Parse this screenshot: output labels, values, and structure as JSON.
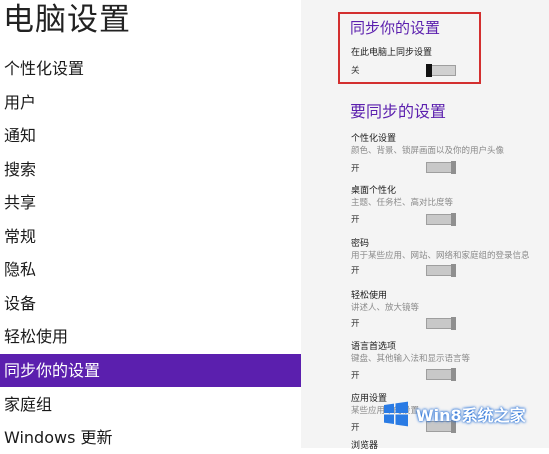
{
  "page": {
    "title": "电脑设置"
  },
  "nav": {
    "items": [
      {
        "label": "个性化设置"
      },
      {
        "label": "用户"
      },
      {
        "label": "通知"
      },
      {
        "label": "搜索"
      },
      {
        "label": "共享"
      },
      {
        "label": "常规"
      },
      {
        "label": "隐私"
      },
      {
        "label": "设备"
      },
      {
        "label": "轻松使用"
      },
      {
        "label": "同步你的设置",
        "selected": true
      },
      {
        "label": "家庭组"
      },
      {
        "label": "Windows 更新"
      }
    ]
  },
  "sync": {
    "heading": "同步你的设置",
    "pc_sync_label": "在此电脑上同步设置",
    "pc_sync_state": "关"
  },
  "items_heading": "要同步的设置",
  "settings": [
    {
      "title": "个性化设置",
      "desc": "颜色、背景、锁屏画面以及你的用户头像",
      "state": "开"
    },
    {
      "title": "桌面个性化",
      "desc": "主题、任务栏、高对比度等",
      "state": "开"
    },
    {
      "title": "密码",
      "desc": "用于某些应用、网站、网络和家庭组的登录信息",
      "state": "开"
    },
    {
      "title": "轻松使用",
      "desc": "讲述人、放大镜等",
      "state": "开"
    },
    {
      "title": "语言首选项",
      "desc": "键盘、其他输入法和显示语言等",
      "state": "开"
    },
    {
      "title": "应用设置",
      "desc": "某些应用中的设置",
      "state": "开"
    },
    {
      "title": "浏览器",
      "desc": "",
      "state": ""
    }
  ],
  "watermark": {
    "text": "Win8系统之家"
  },
  "colors": {
    "accent": "#5b1fae",
    "highlight_border": "#d32f2f"
  }
}
